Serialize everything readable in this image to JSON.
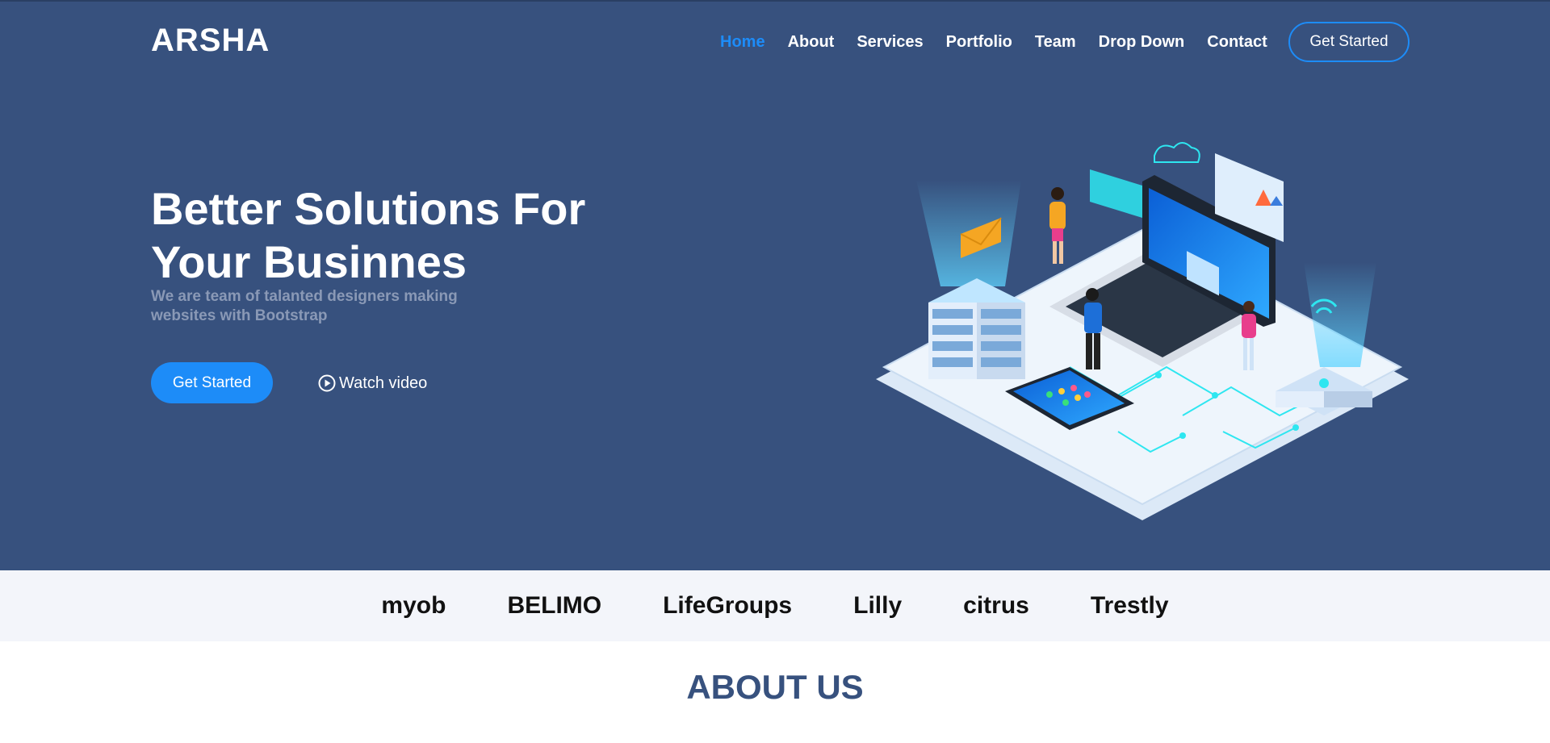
{
  "brand": {
    "logo": "ARSHA"
  },
  "nav": {
    "items": [
      {
        "label": "Home",
        "active": true
      },
      {
        "label": "About"
      },
      {
        "label": "Services"
      },
      {
        "label": "Portfolio"
      },
      {
        "label": "Team"
      },
      {
        "label": "Drop Down"
      },
      {
        "label": "Contact"
      }
    ],
    "cta_label": "Get Started"
  },
  "hero": {
    "title_line1": "Better Solutions For",
    "title_line2": "Your Businnes",
    "subtitle_line1": "We are team of talanted designers making",
    "subtitle_line2": "websites with Bootstrap",
    "primary_button": "Get Started",
    "video_button": "Watch video",
    "illustration_icon": "isometric-tech-illustration"
  },
  "clients": [
    "myob",
    "BELIMO",
    "LifeGroups",
    "Lilly",
    "citrus",
    "Trestly"
  ],
  "about": {
    "title": "ABOUT US"
  },
  "colors": {
    "hero_bg": "#37517e",
    "accent": "#1d8cf8",
    "clients_bg": "#f3f5fa",
    "heading_dark": "#37517e",
    "muted_text": "#8a99b6"
  }
}
